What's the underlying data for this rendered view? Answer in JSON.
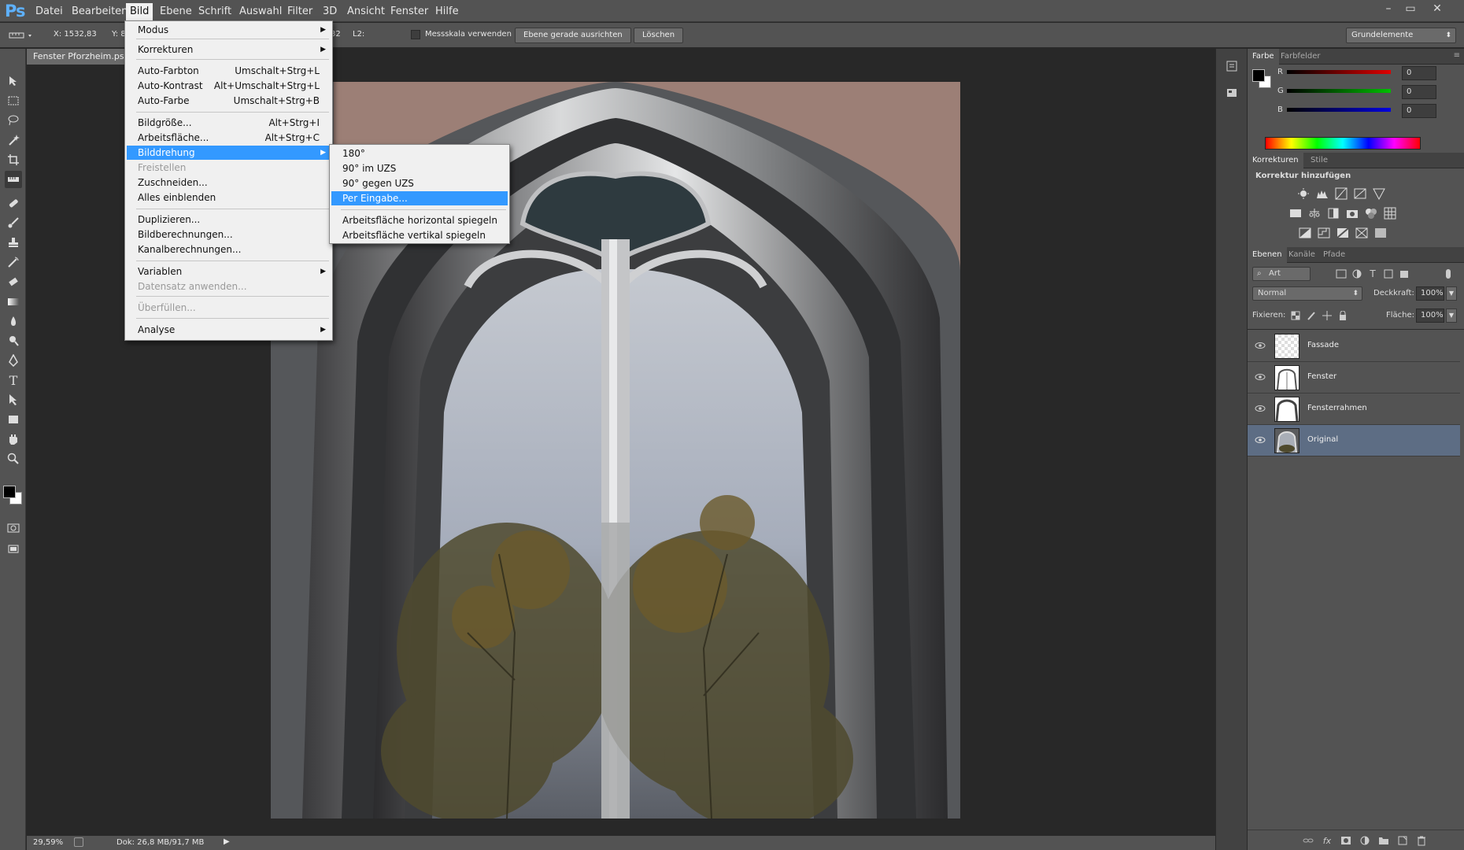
{
  "app": {
    "logo": "Ps"
  },
  "menubar": [
    "Datei",
    "Bearbeiten",
    "Bild",
    "Ebene",
    "Schrift",
    "Auswahl",
    "Filter",
    "3D",
    "Ansicht",
    "Fenster",
    "Hilfe"
  ],
  "window_buttons": [
    "–",
    "▭",
    "✕"
  ],
  "options": {
    "x_label": "X: 1532,83",
    "y_label": "Y: 841",
    "tail_value": "32",
    "l2_label": "L2:",
    "ruler_scale_label": "Messskala verwenden",
    "straighten_button": "Ebene gerade ausrichten",
    "clear_button": "Löschen",
    "workspace": "Grundelemente"
  },
  "document": {
    "tab_title": "Fenster Pforzheim.psd"
  },
  "status": {
    "zoom": "29,59%",
    "doc_size": "Dok: 26,8 MB/91,7 MB"
  },
  "bild_menu": {
    "items": [
      {
        "label": "Modus",
        "submenu": true
      },
      {
        "label": "Korrekturen",
        "submenu": true
      },
      {
        "label": "Auto-Farbton",
        "shortcut": "Umschalt+Strg+L"
      },
      {
        "label": "Auto-Kontrast",
        "shortcut": "Alt+Umschalt+Strg+L"
      },
      {
        "label": "Auto-Farbe",
        "shortcut": "Umschalt+Strg+B"
      },
      {
        "label": "Bildgröße...",
        "shortcut": "Alt+Strg+I"
      },
      {
        "label": "Arbeitsfläche...",
        "shortcut": "Alt+Strg+C"
      },
      {
        "label": "Bilddrehung",
        "submenu": true,
        "highlighted": true
      },
      {
        "label": "Freistellen",
        "disabled": true
      },
      {
        "label": "Zuschneiden..."
      },
      {
        "label": "Alles einblenden"
      },
      {
        "label": "Duplizieren..."
      },
      {
        "label": "Bildberechnungen..."
      },
      {
        "label": "Kanalberechnungen..."
      },
      {
        "label": "Variablen",
        "submenu": true
      },
      {
        "label": "Datensatz anwenden...",
        "disabled": true
      },
      {
        "label": "Überfüllen...",
        "disabled": true
      },
      {
        "label": "Analyse",
        "submenu": true
      }
    ]
  },
  "rotation_menu": {
    "items": [
      {
        "label": "180°"
      },
      {
        "label": "90° im UZS"
      },
      {
        "label": "90° gegen UZS"
      },
      {
        "label": "Per Eingabe...",
        "highlighted": true
      },
      {
        "label": "Arbeitsfläche horizontal spiegeln"
      },
      {
        "label": "Arbeitsfläche vertikal spiegeln"
      }
    ]
  },
  "color_panel": {
    "tabs": [
      "Farbe",
      "Farbfelder"
    ],
    "channels": [
      {
        "name": "R",
        "value": "0",
        "color": "#e00000"
      },
      {
        "name": "G",
        "value": "0",
        "color": "#00c000"
      },
      {
        "name": "B",
        "value": "0",
        "color": "#0000e0"
      }
    ]
  },
  "adjustments_panel": {
    "tabs": [
      "Korrekturen",
      "Stile"
    ],
    "header": "Korrektur hinzufügen"
  },
  "layers_panel": {
    "tabs": [
      "Ebenen",
      "Kanäle",
      "Pfade"
    ],
    "filter_kind": "Art",
    "blend_mode": "Normal",
    "opacity_label": "Deckkraft:",
    "opacity": "100%",
    "lock_label": "Fixieren:",
    "fill_label": "Fläche:",
    "fill": "100%",
    "layers": [
      {
        "name": "Fassade",
        "selected": false
      },
      {
        "name": "Fenster",
        "selected": false
      },
      {
        "name": "Fensterrahmen",
        "selected": false
      },
      {
        "name": "Original",
        "selected": true
      }
    ]
  }
}
